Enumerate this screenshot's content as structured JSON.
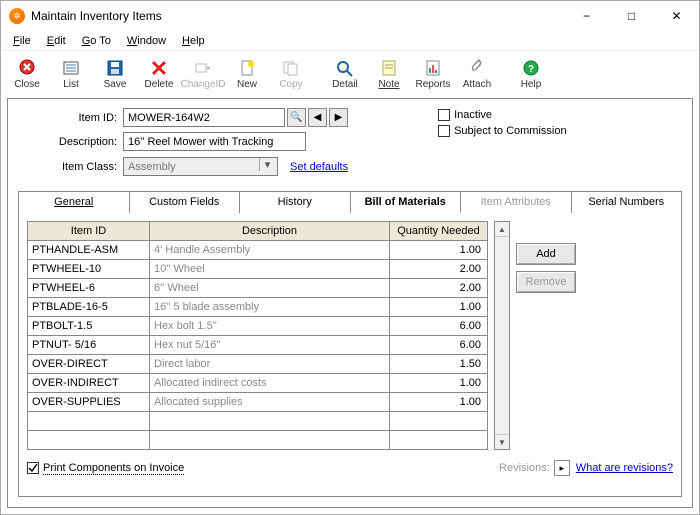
{
  "window": {
    "title": "Maintain Inventory Items"
  },
  "menu": {
    "file": "File",
    "edit": "Edit",
    "goto": "Go To",
    "window": "Window",
    "help": "Help"
  },
  "toolbar": {
    "close": "Close",
    "list": "List",
    "save": "Save",
    "delete": "Delete",
    "changeid": "ChangeID",
    "new": "New",
    "copy": "Copy",
    "detail": "Detail",
    "note": "Note",
    "reports": "Reports",
    "attach": "Attach",
    "help": "Help"
  },
  "labels": {
    "item_id": "Item ID:",
    "description": "Description:",
    "item_class": "Item Class:",
    "inactive": "Inactive",
    "commission": "Subject to Commission",
    "set_defaults": "Set defaults"
  },
  "fields": {
    "item_id": "MOWER-164W2",
    "description": "16'' Reel Mower with Tracking",
    "item_class": "Assembly"
  },
  "tabs": {
    "general": "General",
    "custom": "Custom Fields",
    "history": "History",
    "bom": "Bill of Materials",
    "attrs": "Item Attributes",
    "serial": "Serial Numbers"
  },
  "grid": {
    "cols": {
      "id": "Item ID",
      "desc": "Description",
      "qty": "Quantity Needed"
    },
    "rows": [
      {
        "id": "PTHANDLE-ASM",
        "desc": "4' Handle Assembly",
        "qty": "1.00"
      },
      {
        "id": "PTWHEEL-10",
        "desc": "10'' Wheel",
        "qty": "2.00"
      },
      {
        "id": "PTWHEEL-6",
        "desc": "6'' Wheel",
        "qty": "2.00"
      },
      {
        "id": "PTBLADE-16-5",
        "desc": "16'' 5 blade assembly",
        "qty": "1.00"
      },
      {
        "id": "PTBOLT-1.5",
        "desc": "Hex bolt 1.5''",
        "qty": "6.00"
      },
      {
        "id": "PTNUT- 5/16",
        "desc": "Hex nut 5/16''",
        "qty": "6.00"
      },
      {
        "id": "OVER-DIRECT",
        "desc": "Direct labor",
        "qty": "1.50"
      },
      {
        "id": "OVER-INDIRECT",
        "desc": "Allocated indirect costs",
        "qty": "1.00"
      },
      {
        "id": "OVER-SUPPLIES",
        "desc": "Allocated supplies",
        "qty": "1.00"
      }
    ],
    "add": "Add",
    "remove": "Remove"
  },
  "footer": {
    "print_components": "Print Components on Invoice",
    "revisions_lbl": "Revisions:",
    "revisions_link": "What are revisions?"
  }
}
